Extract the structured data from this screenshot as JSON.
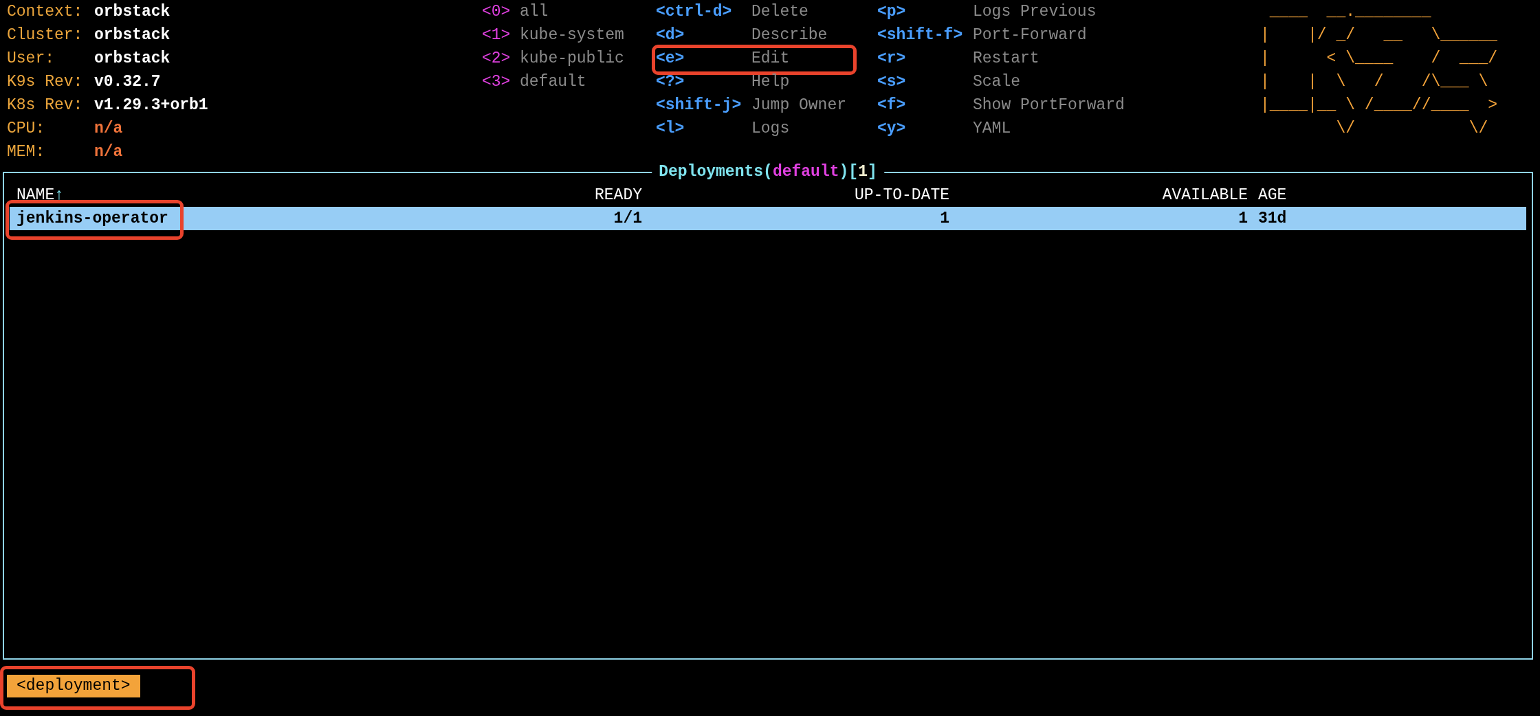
{
  "cluster_info": [
    {
      "label": "Context:",
      "value": "orbstack",
      "kind": "text"
    },
    {
      "label": "Cluster:",
      "value": "orbstack",
      "kind": "text"
    },
    {
      "label": "User:",
      "value": "orbstack",
      "kind": "text"
    },
    {
      "label": "K9s Rev:",
      "value": "v0.32.7",
      "kind": "text"
    },
    {
      "label": "K8s Rev:",
      "value": "v1.29.3+orb1",
      "kind": "text"
    },
    {
      "label": "CPU:",
      "value": "n/a",
      "kind": "metric"
    },
    {
      "label": "MEM:",
      "value": "n/a",
      "kind": "metric"
    }
  ],
  "namespaces": [
    {
      "key": "<0>",
      "name": "all"
    },
    {
      "key": "<1>",
      "name": "kube-system"
    },
    {
      "key": "<2>",
      "name": "kube-public"
    },
    {
      "key": "<3>",
      "name": "default"
    }
  ],
  "hints": [
    [
      {
        "key": "<ctrl-d>",
        "action": "Delete",
        "annotated": false
      },
      {
        "key": "<d>",
        "action": "Describe",
        "annotated": false
      },
      {
        "key": "<e>",
        "action": "Edit",
        "annotated": true
      },
      {
        "key": "<?>",
        "action": "Help",
        "annotated": false
      },
      {
        "key": "<shift-j>",
        "action": "Jump Owner",
        "annotated": false
      },
      {
        "key": "<l>",
        "action": "Logs",
        "annotated": false
      }
    ],
    [
      {
        "key": "<p>",
        "action": "Logs Previous",
        "annotated": false
      },
      {
        "key": "<shift-f>",
        "action": "Port-Forward",
        "annotated": false
      },
      {
        "key": "<r>",
        "action": "Restart",
        "annotated": false
      },
      {
        "key": "<s>",
        "action": "Scale",
        "annotated": false
      },
      {
        "key": "<f>",
        "action": "Show PortForward",
        "annotated": false
      },
      {
        "key": "<y>",
        "action": "YAML",
        "annotated": false
      }
    ]
  ],
  "logo": [
    " ____  __.________       ",
    "|    |/ _/   __   \\______",
    "|      < \\____    /  ___/",
    "|    |  \\   /    /\\___ \\ ",
    "|____|__ \\ /____//____  >",
    "        \\/            \\/ "
  ],
  "table": {
    "title": [
      {
        "text": "Deployments",
        "kind": "resource"
      },
      {
        "text": "(",
        "kind": "bracket"
      },
      {
        "text": "default",
        "kind": "namespace"
      },
      {
        "text": ")",
        "kind": "bracket"
      },
      {
        "text": "[",
        "kind": "bracket"
      },
      {
        "text": "1",
        "kind": "count"
      },
      {
        "text": "]",
        "kind": "bracket"
      }
    ],
    "columns": [
      {
        "label": "NAME",
        "sort_indicator": "↑"
      },
      {
        "label": "READY"
      },
      {
        "label": "UP-TO-DATE"
      },
      {
        "label": "AVAILABLE"
      },
      {
        "label": "AGE"
      }
    ],
    "rows": [
      {
        "selected": true,
        "cells": [
          {
            "text": "jenkins-operator",
            "annotated": true
          },
          {
            "text": "1/1",
            "annotated": false
          },
          {
            "text": "1",
            "annotated": false
          },
          {
            "text": "1",
            "annotated": false
          },
          {
            "text": "31d",
            "annotated": false
          }
        ]
      }
    ]
  },
  "crumbs": [
    {
      "text": "<deployment>",
      "annotated": true
    }
  ]
}
